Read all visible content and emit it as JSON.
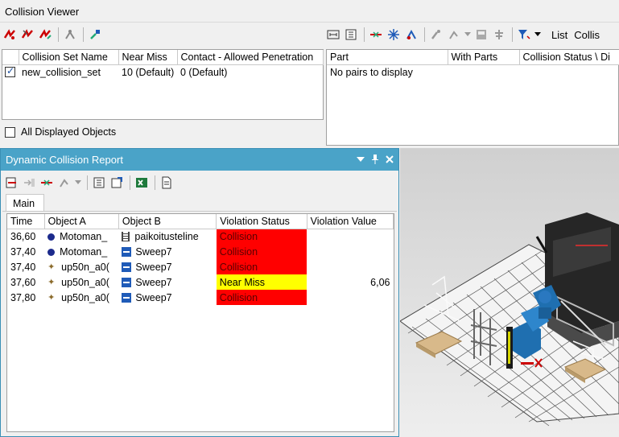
{
  "collision_viewer": {
    "title": "Collision Viewer",
    "list_label": "List",
    "collision_truncated": "Collis",
    "columns": [
      "Collision Set Name",
      "Near Miss",
      "Contact - Allowed Penetration"
    ],
    "rows": [
      {
        "checked": true,
        "name": "new_collision_set",
        "near_miss": "10 (Default)",
        "contact": "0 (Default)"
      }
    ],
    "all_displayed_label": "All Displayed Objects",
    "pairs_columns": [
      "Part",
      "With Parts",
      "Collision Status \\ Di"
    ],
    "pairs_empty": "No pairs to display"
  },
  "dynamic_report": {
    "title": "Dynamic Collision Report",
    "tab": "Main",
    "columns": [
      "Time",
      "Object A",
      "Object B",
      "Violation Status",
      "Violation Value"
    ],
    "rows": [
      {
        "time": "36,60",
        "a_icon": "robot-dot-icon",
        "object_a": "Motoman_",
        "b_icon": "fixture-icon",
        "object_b": "paikoitusteline",
        "status": "Collision",
        "value": ""
      },
      {
        "time": "37,40",
        "a_icon": "robot-dot-icon",
        "object_a": "Motoman_",
        "b_icon": "sweep-icon",
        "object_b": "Sweep7",
        "status": "Collision",
        "value": ""
      },
      {
        "time": "37,40",
        "a_icon": "robot-arm-icon",
        "object_a": "up50n_a0(",
        "b_icon": "sweep-icon",
        "object_b": "Sweep7",
        "status": "Collision",
        "value": ""
      },
      {
        "time": "37,60",
        "a_icon": "robot-arm-icon",
        "object_a": "up50n_a0(",
        "b_icon": "sweep-icon",
        "object_b": "Sweep7",
        "status": "Near Miss",
        "value": "6,06"
      },
      {
        "time": "37,80",
        "a_icon": "robot-arm-icon",
        "object_a": "up50n_a0(",
        "b_icon": "sweep-icon",
        "object_b": "Sweep7",
        "status": "Collision",
        "value": ""
      }
    ]
  },
  "colors": {
    "collision": "#ff0000",
    "near_miss": "#ffff00",
    "panel_title_bg": "#4aa3c8"
  }
}
